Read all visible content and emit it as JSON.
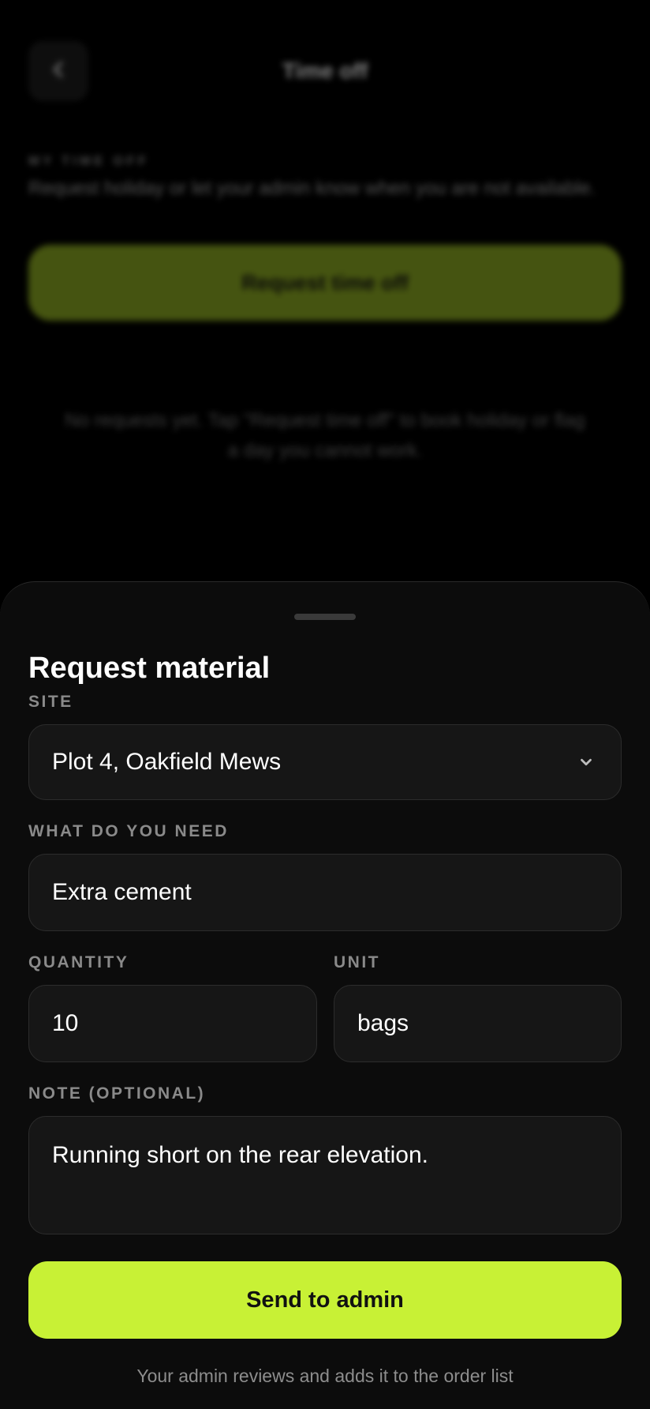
{
  "background": {
    "title": "Time off",
    "eyebrow": "MY TIME OFF",
    "description": "Request holiday or let your admin know when you are not available.",
    "cta_label": "Request time off",
    "empty_state": "No requests yet. Tap \"Request time off\" to book holiday or flag a day you cannot work."
  },
  "sheet": {
    "title": "Request material",
    "site": {
      "label": "SITE",
      "value": "Plot 4, Oakfield Mews"
    },
    "need": {
      "label": "WHAT DO YOU NEED",
      "value": "Extra cement"
    },
    "quantity": {
      "label": "QUANTITY",
      "value": "10"
    },
    "unit": {
      "label": "UNIT",
      "value": "bags"
    },
    "note": {
      "label": "NOTE (OPTIONAL)",
      "value": "Running short on the rear elevation."
    },
    "submit_label": "Send to admin",
    "footer": "Your admin reviews and adds it to the order list"
  },
  "colors": {
    "accent": "#c8f135",
    "sheet_bg": "#0c0c0c",
    "field_bg": "#161616"
  },
  "icons": {
    "back": "chevron-left-icon",
    "dropdown": "chevron-down-icon"
  }
}
